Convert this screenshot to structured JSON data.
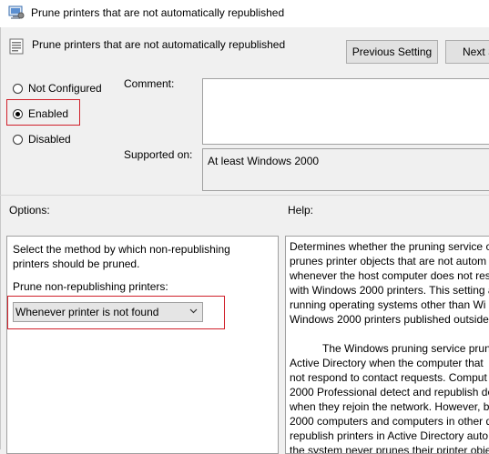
{
  "window": {
    "title": "Prune printers that are not automatically republished"
  },
  "header": {
    "title": "Prune printers that are not automatically republished",
    "previous_button": "Previous Setting",
    "next_button": "Next S"
  },
  "state": {
    "options": [
      {
        "label": "Not Configured",
        "checked": false
      },
      {
        "label": "Enabled",
        "checked": true
      },
      {
        "label": "Disabled",
        "checked": false
      }
    ]
  },
  "comment_label": "Comment:",
  "comment_value": "",
  "supported_label": "Supported on:",
  "supported_value": "At least Windows 2000",
  "options_label": "Options:",
  "help_label": "Help:",
  "options_panel": {
    "description_line1": "Select the method by which non-republishing",
    "description_line2": "printers should be pruned.",
    "prune_label": "Prune non-republishing printers:",
    "prune_selected": "Whenever printer is not found"
  },
  "help_panel": {
    "lines": [
      "Determines whether the pruning service c",
      "prunes printer objects that are not autom",
      "whenever the host computer does not res",
      "with Windows 2000 printers. This setting a",
      "running operating systems other than Wi",
      "Windows 2000 printers published outside"
    ],
    "lines2": [
      "The Windows pruning service prun",
      "Active Directory when the computer that",
      "not respond to contact requests. Comput",
      "2000 Professional detect and republish de",
      "when they rejoin the network. However, b",
      "2000 computers and computers in other d",
      "republish printers in Active Directory auto",
      "the system never prunes their printer obje"
    ]
  }
}
